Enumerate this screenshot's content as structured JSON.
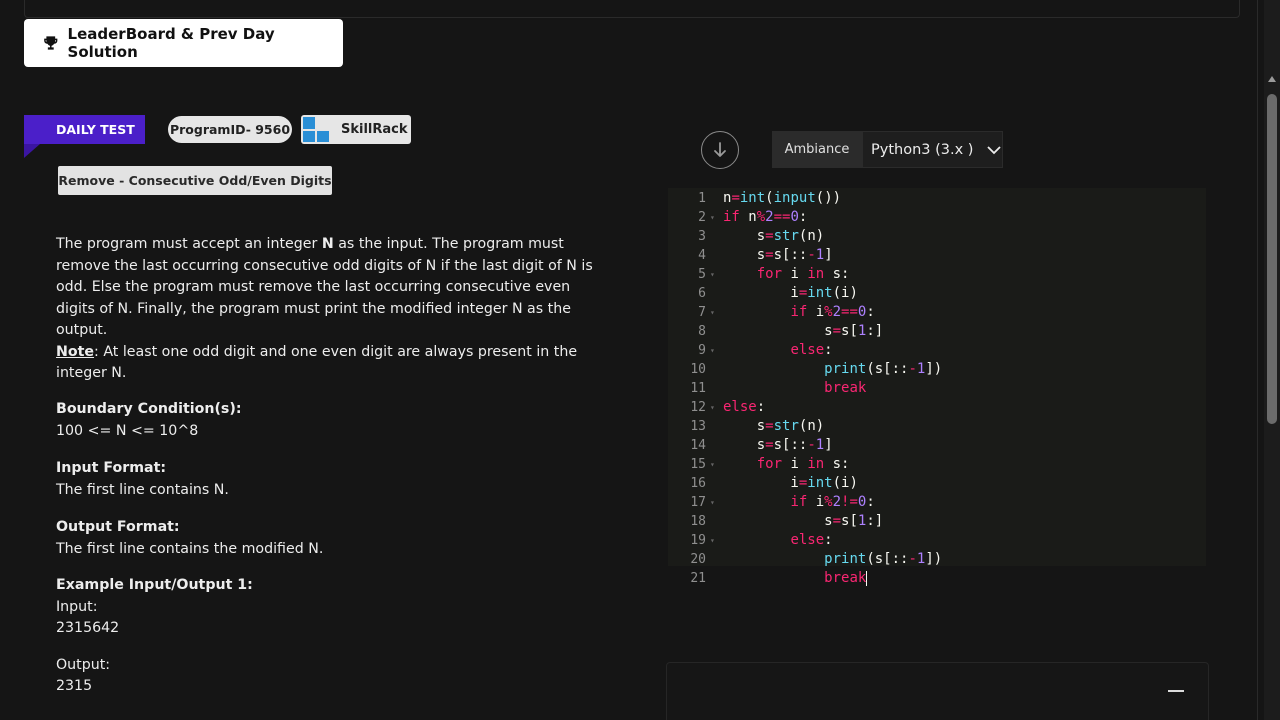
{
  "leaderboard": {
    "label": "LeaderBoard & Prev Day Solution"
  },
  "tags": {
    "daily": "DAILY TEST",
    "program_id": "ProgramID- 9560",
    "skillrack": "SkillRack"
  },
  "problem": {
    "title": "Remove - Consecutive Odd/Even Digits",
    "desc_1": "The program must accept an integer ",
    "desc_n": "N",
    "desc_2": " as the input. The program must remove the last occurring consecutive odd digits of N if the last digit of N is odd. Else the program must remove the last occurring consecutive even digits of N. Finally, the program must print the modified integer N as the output.",
    "note_label": "Note",
    "note_text": ": At least one odd digit and one even digit are always present in the integer N.",
    "boundary_heading": "Boundary Condition(s):",
    "boundary_value": "100 <= N <= 10^8",
    "input_heading": "Input Format:",
    "input_text": "The first line contains N.",
    "output_heading": "Output Format:",
    "output_text": "The first line contains the modified N.",
    "example_heading": "Example Input/Output 1:",
    "example_input_label": "Input:",
    "example_input": "2315642",
    "example_output_label": "Output:",
    "example_output": "2315"
  },
  "editor": {
    "ambiance_label": "Ambiance",
    "language": "Python3 (3.x )",
    "lines": [
      "n=int(input())",
      "if n%2==0:",
      "    s=str(n)",
      "    s=s[::-1]",
      "    for i in s:",
      "        i=int(i)",
      "        if i%2==0:",
      "            s=s[1:]",
      "        else:",
      "            print(s[::-1])",
      "            break",
      "else:",
      "    s=str(n)",
      "    s=s[::-1]",
      "    for i in s:",
      "        i=int(i)",
      "        if i%2!=0:",
      "            s=s[1:]",
      "        else:",
      "            print(s[::-1])",
      "            break"
    ],
    "fold_lines": [
      2,
      5,
      7,
      9,
      12,
      15,
      17,
      19
    ]
  }
}
